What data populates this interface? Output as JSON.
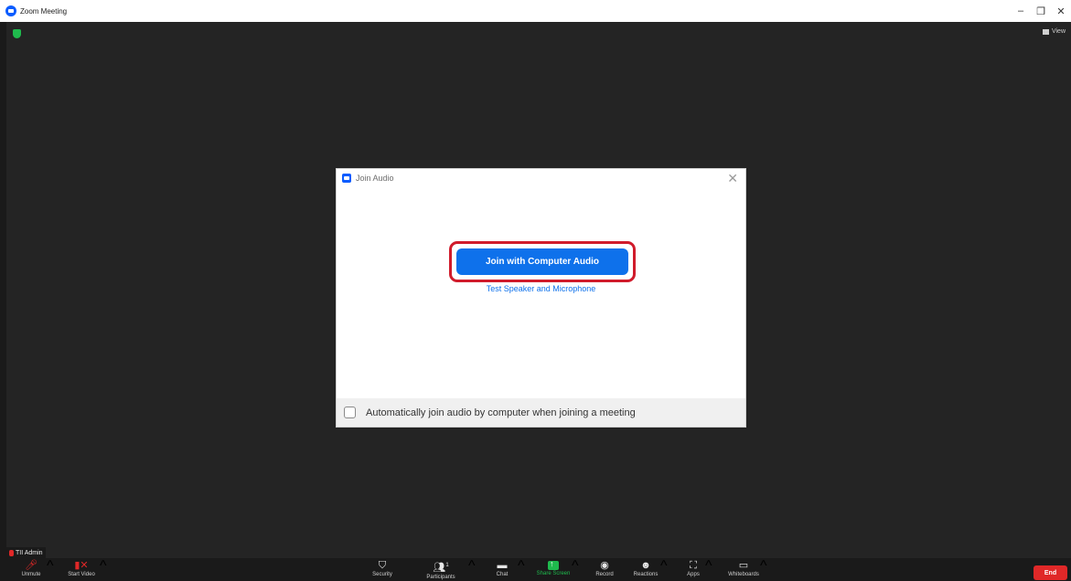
{
  "window": {
    "title": "Zoom Meeting",
    "controls": {
      "minimize": "–",
      "restore": "❐",
      "close": "✕"
    }
  },
  "meeting": {
    "view_label": "View",
    "participant_name": "TII Admin"
  },
  "dialog": {
    "title": "Join Audio",
    "close_glyph": "✕",
    "join_button": "Join with Computer Audio",
    "test_link": "Test Speaker and Microphone",
    "auto_join_label": "Automatically join audio by computer when joining a meeting",
    "auto_join_checked": false
  },
  "toolbar": {
    "unmute": {
      "label": "Unmute",
      "icon": "mic-muted-icon"
    },
    "start_video": {
      "label": "Start Video",
      "icon": "video-off-icon"
    },
    "security": {
      "label": "Security",
      "icon": "shield-icon"
    },
    "participants": {
      "label": "Participants",
      "count": "1",
      "icon": "participants-icon"
    },
    "chat": {
      "label": "Chat",
      "icon": "chat-icon"
    },
    "share_screen": {
      "label": "Share Screen",
      "icon": "share-screen-icon"
    },
    "record": {
      "label": "Record",
      "icon": "record-icon"
    },
    "reactions": {
      "label": "Reactions",
      "icon": "reactions-icon"
    },
    "apps": {
      "label": "Apps",
      "icon": "apps-icon"
    },
    "whiteboards": {
      "label": "Whiteboards",
      "icon": "whiteboard-icon"
    },
    "end": "End"
  },
  "colors": {
    "accent": "#0e71eb",
    "highlight_frame": "#d01b2b",
    "end": "#e02828",
    "secure_green": "#1fba4d"
  }
}
